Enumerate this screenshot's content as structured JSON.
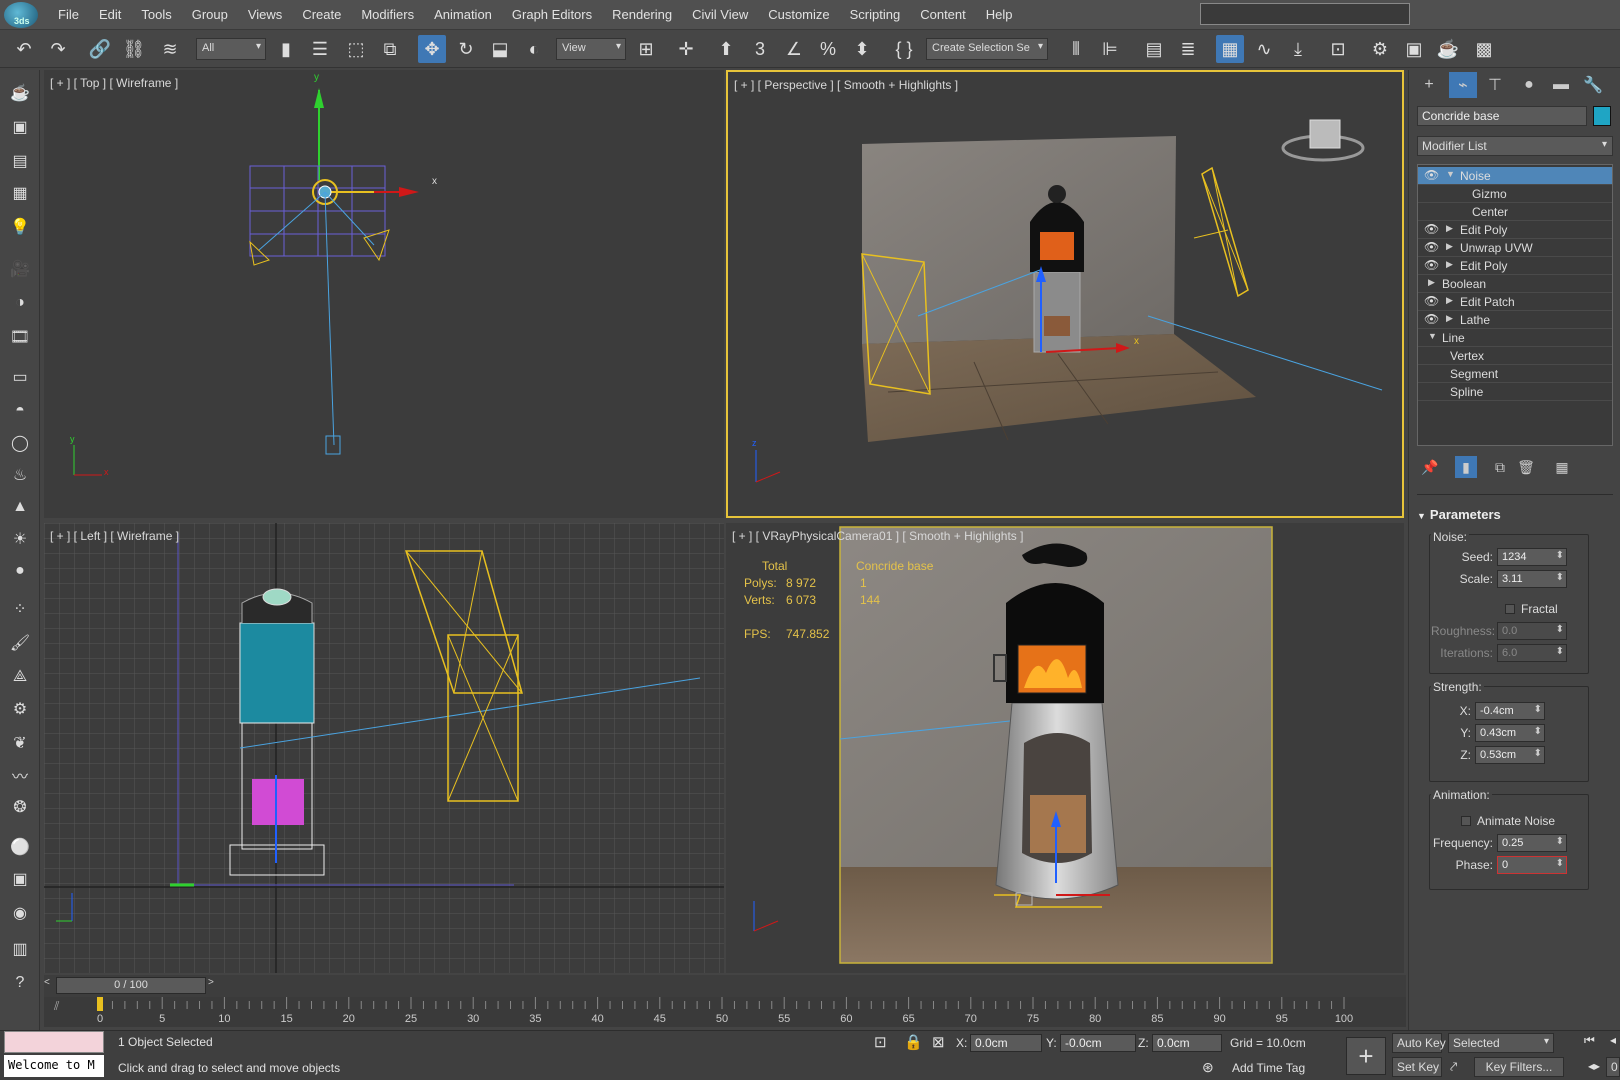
{
  "app": {
    "logo_text": "3ds"
  },
  "menu": [
    "File",
    "Edit",
    "Tools",
    "Group",
    "Views",
    "Create",
    "Modifiers",
    "Animation",
    "Graph Editors",
    "Rendering",
    "Civil View",
    "Customize",
    "Scripting",
    "Content",
    "Help"
  ],
  "toolbar": {
    "selection_filter": "All",
    "ref_coord": "View",
    "selection_set": "Create Selection Se",
    "icons": [
      "undo-icon",
      "redo-icon",
      "link-icon",
      "unlink-icon",
      "bind-spacewarp-icon",
      "select-object-icon",
      "select-by-name-icon",
      "rect-region-icon",
      "window-crossing-icon",
      "select-move-icon",
      "select-rotate-icon",
      "select-scale-icon",
      "placement-icon",
      "pivot-icon",
      "keyboard-shortcut-icon",
      "snaps-icon",
      "angle-snap-icon",
      "percent-snap-icon",
      "spinner-snap-icon",
      "named-selection-icon",
      "mirror-icon",
      "align-icon",
      "scene-explorer-icon",
      "layer-explorer-icon",
      "ribbon-icon",
      "curve-editor-icon",
      "schematic-icon",
      "material-editor-icon",
      "render-setup-icon",
      "rendered-frame-icon",
      "render-icon",
      "render-online-icon"
    ]
  },
  "viewports": {
    "top": {
      "label": "[ + ] [ Top ] [ Wireframe ]"
    },
    "perspective": {
      "label": "[ + ] [ Perspective ] [ Smooth + Highlights ]"
    },
    "left": {
      "label": "[ + ] [ Left ] [ Wireframe ]"
    },
    "camera": {
      "label": "[ + ] [ VRayPhysicalCamera01 ] [ Smooth + Highlights ]"
    }
  },
  "stats": {
    "total_header": "Total",
    "object_header": "Concride base",
    "polys_label": "Polys:",
    "polys_total": "8 972",
    "polys_obj": "1",
    "verts_label": "Verts:",
    "verts_total": "6 073",
    "verts_obj": "144",
    "fps_label": "FPS:",
    "fps_value": "747.852"
  },
  "command_panel": {
    "object_name": "Concride base",
    "object_color": "#1fa5c4",
    "modifier_list": "Modifier List",
    "stack": [
      {
        "label": "Noise",
        "eye": true,
        "expanded": true,
        "selected": true,
        "indent": 0
      },
      {
        "label": "Gizmo",
        "eye": false,
        "indent": 2
      },
      {
        "label": "Center",
        "eye": false,
        "indent": 2
      },
      {
        "label": "Edit Poly",
        "eye": true,
        "indent": 0
      },
      {
        "label": "Unwrap UVW",
        "eye": true,
        "indent": 0
      },
      {
        "label": "Edit Poly",
        "eye": true,
        "indent": 0
      },
      {
        "label": "Boolean",
        "eye": false,
        "indent": 0
      },
      {
        "label": "Edit Patch",
        "eye": true,
        "indent": 0
      },
      {
        "label": "Lathe",
        "eye": true,
        "indent": 0
      },
      {
        "label": "Line",
        "eye": false,
        "expanded": true,
        "indent": 0
      },
      {
        "label": "Vertex",
        "eye": false,
        "indent": 1
      },
      {
        "label": "Segment",
        "eye": false,
        "indent": 1
      },
      {
        "label": "Spline",
        "eye": false,
        "indent": 1
      }
    ],
    "parameters": {
      "title": "Parameters",
      "noise_group": "Noise:",
      "seed_label": "Seed:",
      "seed": "1234",
      "scale_label": "Scale:",
      "scale": "3.11",
      "fractal_label": "Fractal",
      "roughness_label": "Roughness:",
      "roughness": "0.0",
      "iterations_label": "Iterations:",
      "iterations": "6.0",
      "strength_group": "Strength:",
      "x_label": "X:",
      "x": "-0.4cm",
      "y_label": "Y:",
      "y": "0.43cm",
      "z_label": "Z:",
      "z": "0.53cm",
      "animation_group": "Animation:",
      "animate_noise_label": "Animate Noise",
      "frequency_label": "Frequency:",
      "frequency": "0.25",
      "phase_label": "Phase:",
      "phase": "0"
    }
  },
  "timeline": {
    "slider": "0 / 100",
    "ticks": [
      "0",
      "5",
      "10",
      "15",
      "20",
      "25",
      "30",
      "35",
      "40",
      "45",
      "50",
      "55",
      "60",
      "65",
      "70",
      "75",
      "80",
      "85",
      "90",
      "95",
      "100"
    ]
  },
  "status": {
    "selected": "1 Object Selected",
    "prompt": "Click and drag to select and move objects",
    "welcome": "Welcome to M",
    "x_label": "X:",
    "x": "0.0cm",
    "y_label": "Y:",
    "y": "-0.0cm",
    "z_label": "Z:",
    "z": "0.0cm",
    "grid": "Grid = 10.0cm",
    "add_time_tag": "Add Time Tag",
    "auto_key": "Auto Key",
    "selected_dd": "Selected",
    "set_key": "Set Key",
    "key_filters": "Key Filters...",
    "frame": "0"
  }
}
